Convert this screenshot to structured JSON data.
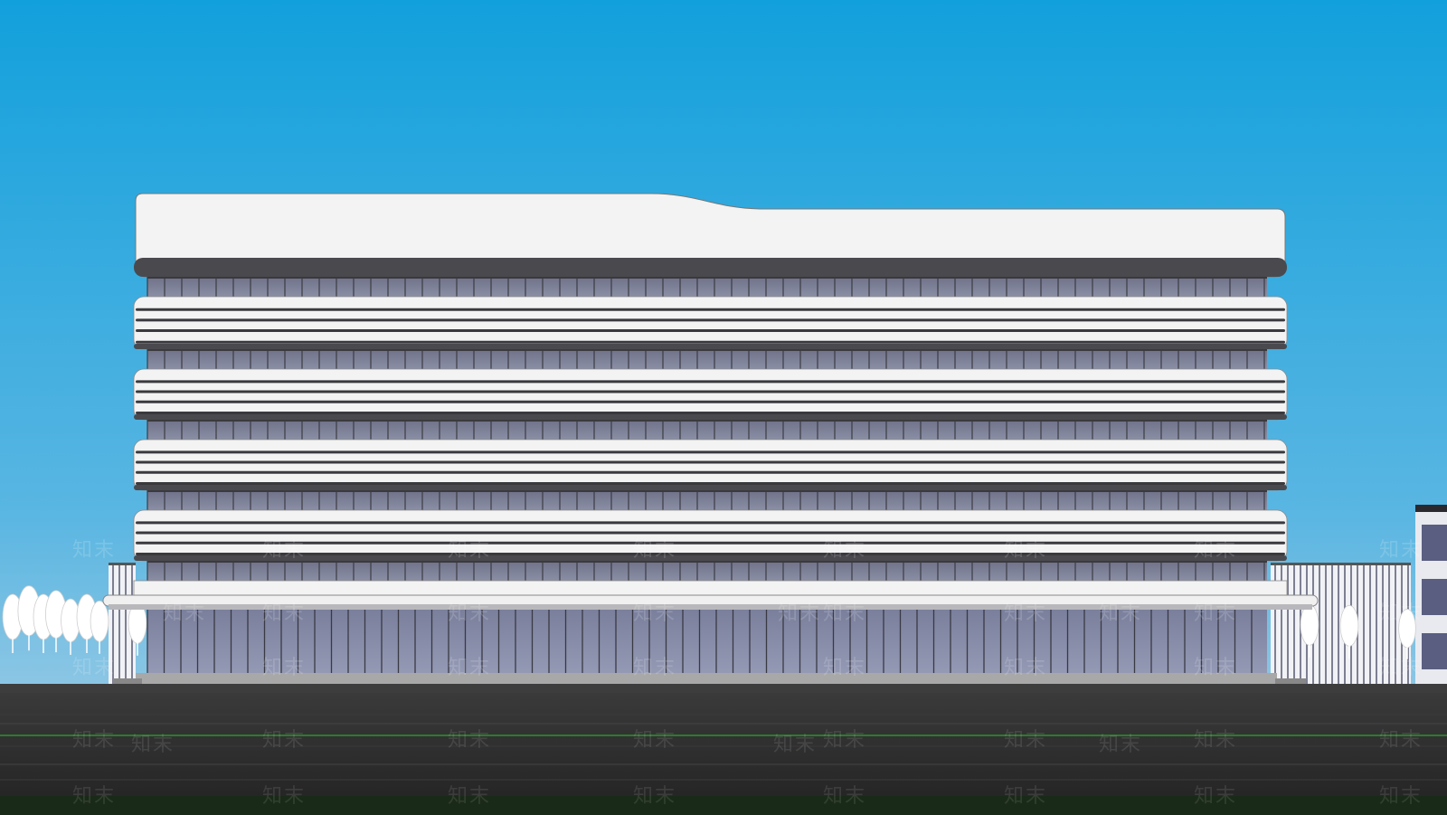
{
  "scene": {
    "subject": "building-elevation-render",
    "colors": {
      "sky_top": "#12a0dc",
      "sky_bottom": "#5ab6e2",
      "facade_white": "#f2f2f2",
      "band_shadow": "#3a3a3e",
      "glazing": "#7c7f94",
      "ground_glazing": "#848aa4",
      "road": "#2b2b2b",
      "grass": "#3a4a2c",
      "tree": "#ffffff"
    },
    "floors_with_ribbon_windows": 5
  },
  "watermark": {
    "text": "知末"
  }
}
